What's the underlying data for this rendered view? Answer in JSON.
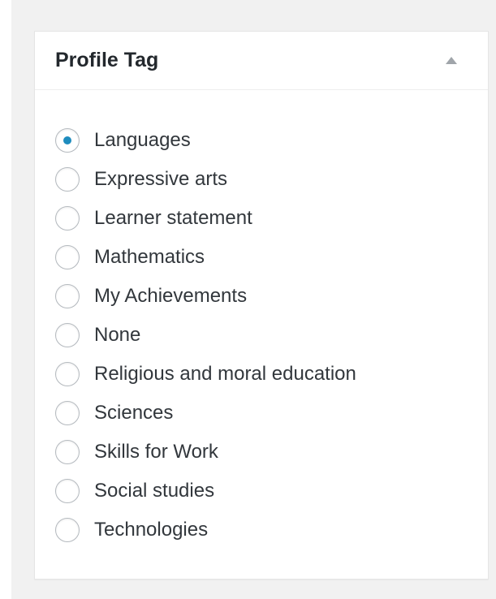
{
  "panel": {
    "title": "Profile Tag",
    "toggle_icon": "triangle-up-icon"
  },
  "options": [
    {
      "label": "Languages",
      "checked": true
    },
    {
      "label": "Expressive arts",
      "checked": false
    },
    {
      "label": "Learner statement",
      "checked": false
    },
    {
      "label": "Mathematics",
      "checked": false
    },
    {
      "label": "My Achievements",
      "checked": false
    },
    {
      "label": "None",
      "checked": false
    },
    {
      "label": "Religious and moral education",
      "checked": false
    },
    {
      "label": "Sciences",
      "checked": false
    },
    {
      "label": "Skills for Work",
      "checked": false
    },
    {
      "label": "Social studies",
      "checked": false
    },
    {
      "label": "Technologies",
      "checked": false
    }
  ],
  "colors": {
    "radio_checked_dot": "#1e8cbe",
    "title_text": "#23282d",
    "label_text": "#32373c",
    "backdrop": "#f1f1f1"
  }
}
